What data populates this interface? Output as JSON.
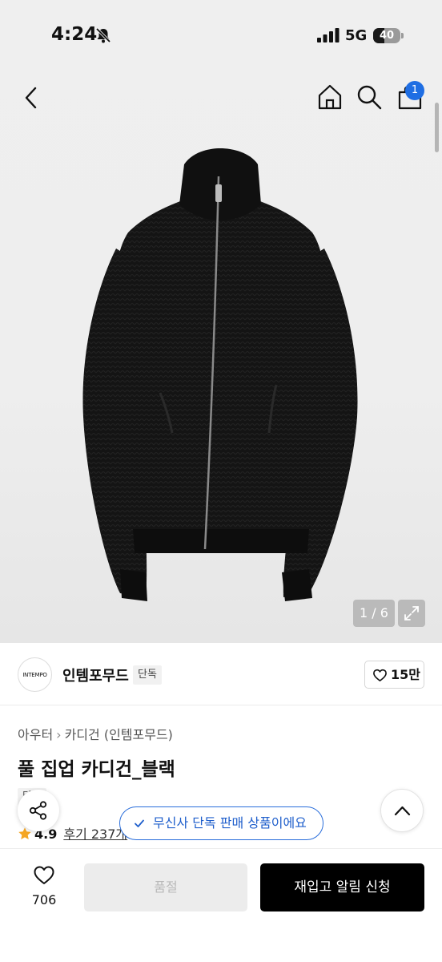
{
  "status_bar": {
    "time": "4:24",
    "network": "5G",
    "battery": "40"
  },
  "nav": {
    "cart_count": "1"
  },
  "gallery": {
    "counter": "1 / 6"
  },
  "brand": {
    "logo_text": "INTEMPO",
    "name": "인템포무드",
    "exclusive_tag": "단독",
    "likes": "15만"
  },
  "breadcrumb": [
    "아우터",
    "카디건 (인템포무드)"
  ],
  "product": {
    "title": "풀 집업 카디건_블랙",
    "badge": "단독",
    "rating": "4.9",
    "reviews": "후기 237개"
  },
  "toast": {
    "text": "무신사 단독 판매 상품이에요"
  },
  "bottom_bar": {
    "wish_count": "706",
    "soldout_label": "품절",
    "restock_label": "재입고 알림 신청"
  },
  "colors": {
    "accent_blue": "#1f6ee3",
    "primary_button": "#000000",
    "disabled_button": "#ececec",
    "rating_star": "#f5a623"
  }
}
